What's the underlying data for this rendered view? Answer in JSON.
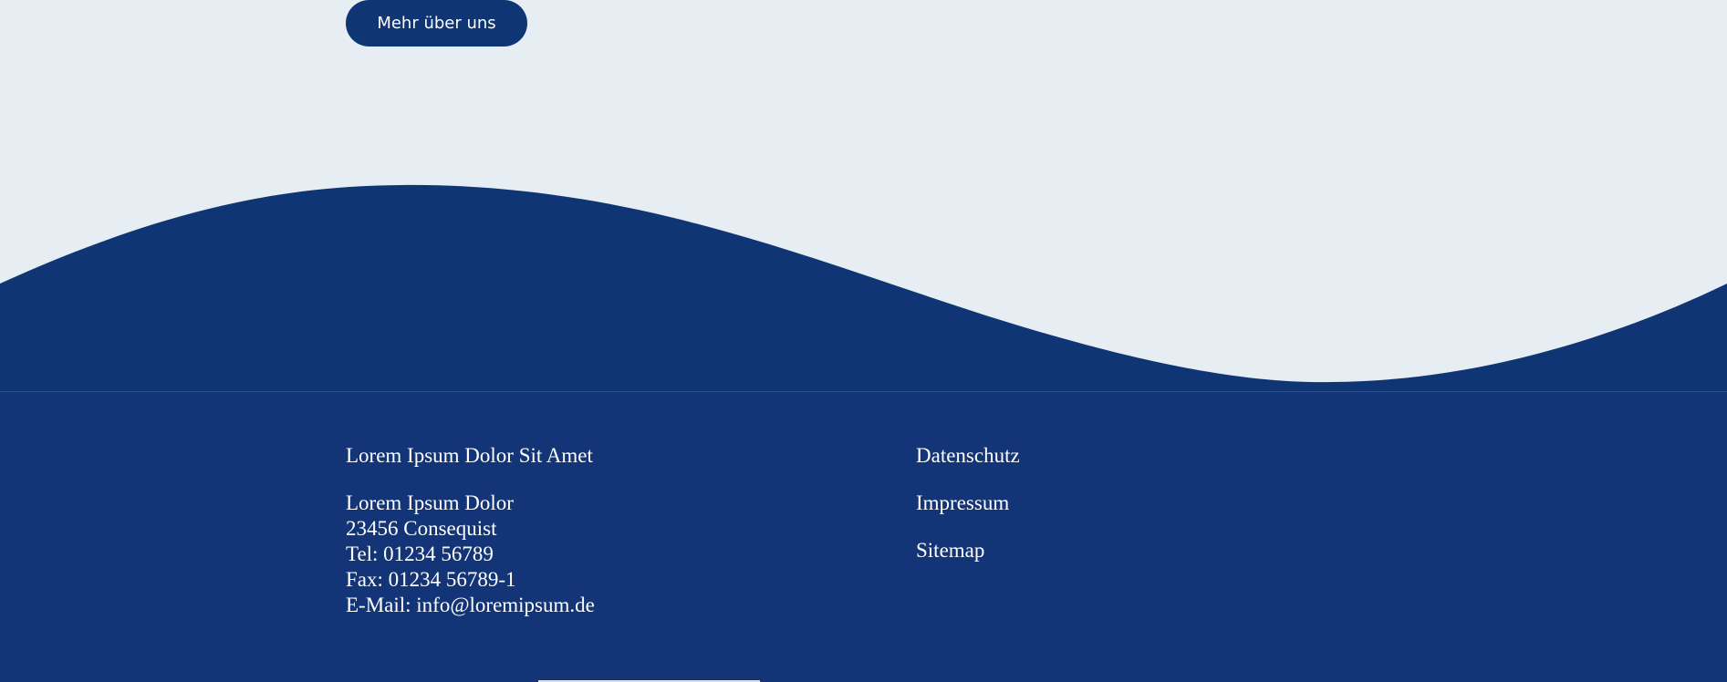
{
  "hero": {
    "cta_label": "Mehr über uns"
  },
  "colors": {
    "background_light": "#e6edf3",
    "navy": "#0f3575",
    "footer_bg": "#133577",
    "text_light": "#ffffff"
  },
  "footer": {
    "company_name": "Lorem Ipsum Dolor Sit Amet",
    "address": [
      "Lorem Ipsum Dolor",
      "23456 Consequist",
      "Tel: 01234 56789",
      "Fax: 01234 56789-1",
      "E-Mail: info@loremipsum.de"
    ],
    "links": [
      "Datenschutz",
      "Impressum",
      "Sitemap"
    ]
  }
}
